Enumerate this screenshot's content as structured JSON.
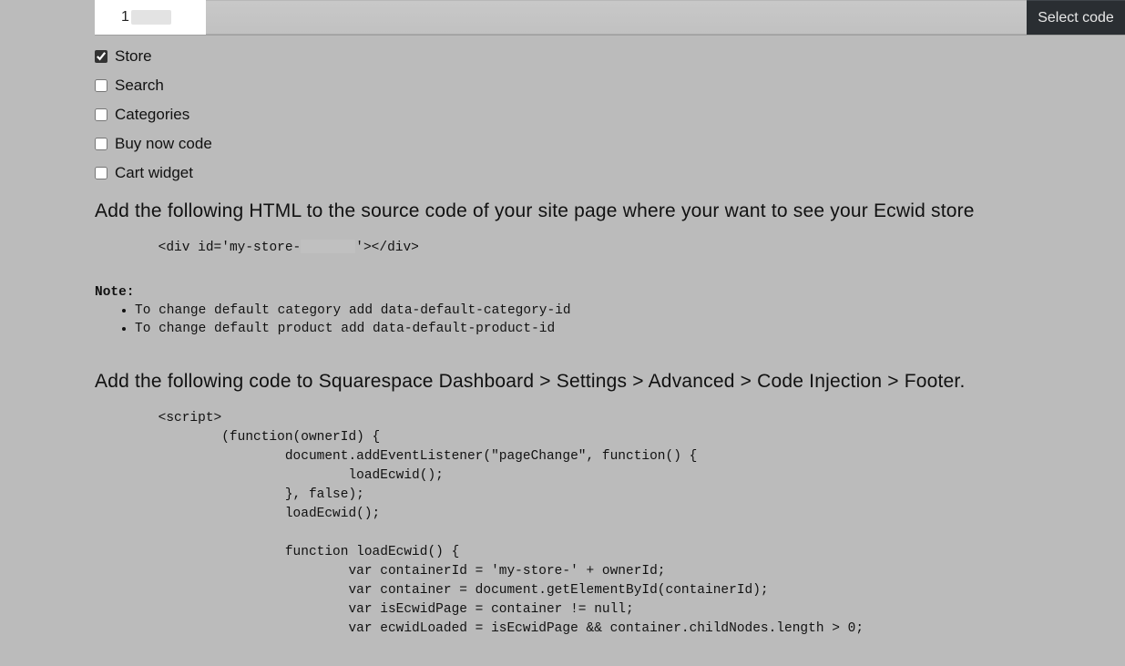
{
  "topbar": {
    "id_prefix": "1"
  },
  "select_code_btn": "Select code",
  "checkboxes": {
    "store": {
      "label": "Store",
      "checked": true
    },
    "search": {
      "label": "Search",
      "checked": false
    },
    "categories": {
      "label": "Categories",
      "checked": false
    },
    "buynow": {
      "label": "Buy now code",
      "checked": false
    },
    "cart": {
      "label": "Cart widget",
      "checked": false
    }
  },
  "heading_html": "Add the following HTML to the source code of your site page where your want to see your Ecwid store",
  "code_div_pre": "<div id='my-store-",
  "code_div_post": "'></div>",
  "note_label": "Note:",
  "note_items": [
    "To change default category add data-default-category-id",
    "To change default product add data-default-product-id"
  ],
  "heading_injection": "Add the following code to Squarespace Dashboard > Settings > Advanced > Code Injection > Footer.",
  "script_lines": [
    "<script>",
    "        (function(ownerId) {",
    "                document.addEventListener(\"pageChange\", function() {",
    "                        loadEcwid();",
    "                }, false);",
    "                loadEcwid();",
    "",
    "                function loadEcwid() {",
    "                        var containerId = 'my-store-' + ownerId;",
    "                        var container = document.getElementById(containerId);",
    "                        var isEcwidPage = container != null;",
    "                        var ecwidLoaded = isEcwidPage && container.childNodes.length > 0;"
  ]
}
